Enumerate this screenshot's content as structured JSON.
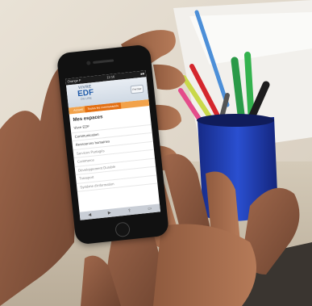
{
  "phone": {
    "status_carrier": "Orange F",
    "status_time": "12:16",
    "status_battery": "■■"
  },
  "site": {
    "logo_line1": "VIVRE",
    "logo_line2": "EDF",
    "logo_line3": "ON LINE",
    "close_label": "Fermer"
  },
  "tabs": [
    {
      "label": "Accueil"
    },
    {
      "label": "Toutes les communautés"
    }
  ],
  "menu": {
    "title": "Mes espaces",
    "items": [
      {
        "label": "Vivre EDF"
      },
      {
        "label": "Communication"
      },
      {
        "label": "Ressources humaines"
      },
      {
        "label": "Services Partagés"
      },
      {
        "label": "Commerce"
      },
      {
        "label": "Développement Durable"
      },
      {
        "label": "Transport"
      },
      {
        "label": "Système d'information"
      }
    ]
  },
  "colors": {
    "tab_bar": "#f2a24a",
    "tab_active": "#e36f12",
    "logo_blue": "#1f5aa8",
    "cup_blue": "#1f3aa6"
  }
}
